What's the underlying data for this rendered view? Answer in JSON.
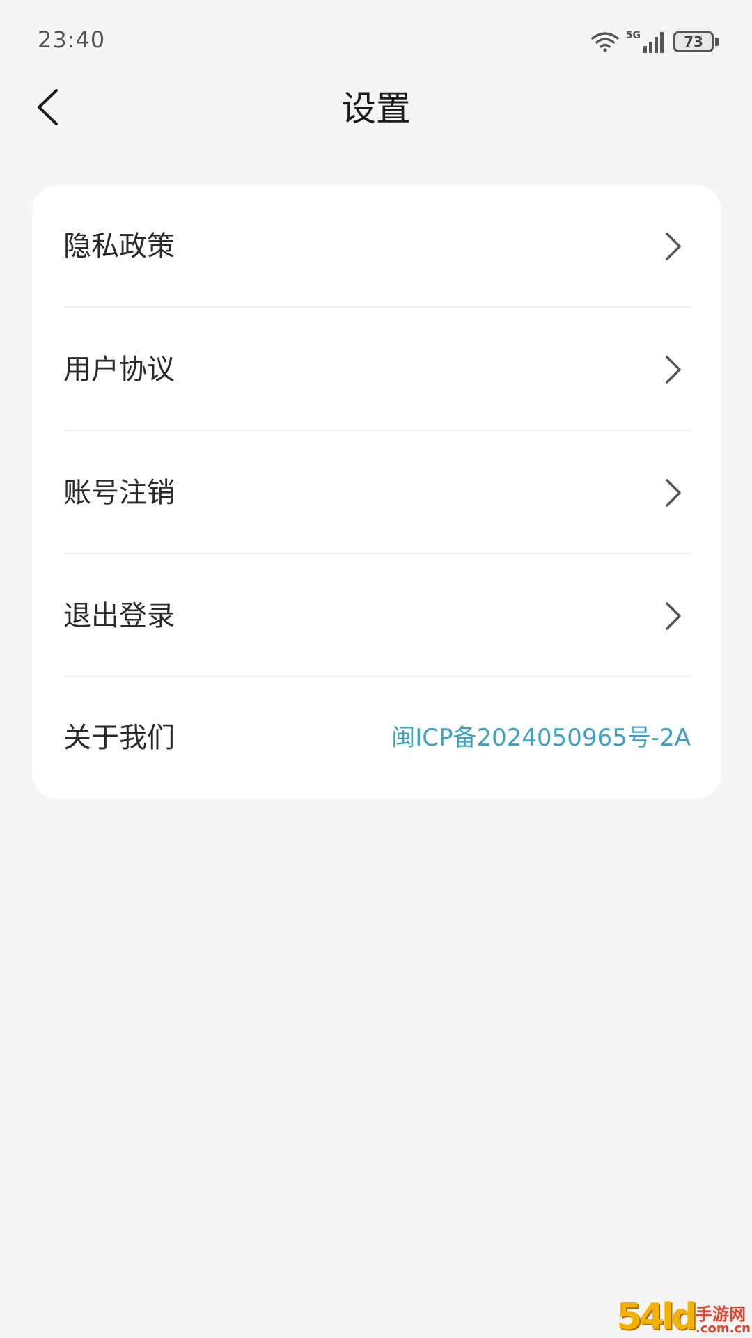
{
  "status_bar": {
    "time": "23:40",
    "network_label": "5G",
    "battery_level": "73"
  },
  "header": {
    "title": "设置"
  },
  "settings": {
    "items": [
      {
        "label": "隐私政策"
      },
      {
        "label": "用户协议"
      },
      {
        "label": "账号注销"
      },
      {
        "label": "退出登录"
      },
      {
        "label": "关于我们",
        "value": "闽ICP备2024050965号-2A"
      }
    ]
  },
  "watermark": {
    "digits": "54ld",
    "cn": "手游网",
    "domain": ".com.cn"
  },
  "colors": {
    "background": "#f5f5f5",
    "card": "#ffffff",
    "link": "#3fa0bf"
  }
}
